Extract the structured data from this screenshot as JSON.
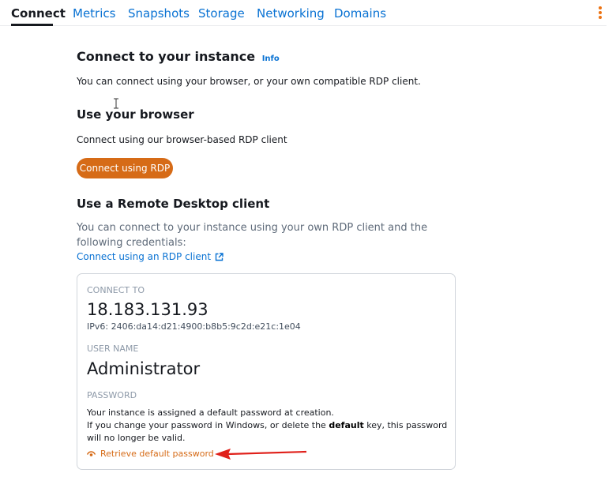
{
  "tabs": [
    {
      "label": "Connect",
      "active": true
    },
    {
      "label": "Metrics",
      "active": false
    },
    {
      "label": "Snapshots",
      "active": false
    },
    {
      "label": "Storage",
      "active": false
    },
    {
      "label": "Networking",
      "active": false
    },
    {
      "label": "Domains",
      "active": false
    }
  ],
  "connect": {
    "title": "Connect to your instance",
    "info_label": "Info",
    "intro": "You can connect using your browser, or your own compatible RDP client."
  },
  "browser": {
    "heading": "Use your browser",
    "text": "Connect using our browser-based RDP client",
    "button_label": "Connect using RDP"
  },
  "rdp_client": {
    "heading": "Use a Remote Desktop client",
    "description": "You can connect to your instance using your own RDP client and the following credentials:",
    "link_label": "Connect using an RDP client"
  },
  "credentials": {
    "connect_to_label": "CONNECT TO",
    "ip": "18.183.131.93",
    "ipv6": "IPv6: 2406:da14:d21:4900:b8b5:9c2d:e21c:1e04",
    "username_label": "USER NAME",
    "username": "Administrator",
    "password_label": "PASSWORD",
    "password_line1": "Your instance is assigned a default password at creation.",
    "password_line2_pre": "If you change your password in Windows, or delete the ",
    "password_line2_bold": "default",
    "password_line2_post": " key, this password will no longer be valid.",
    "retrieve_label": "Retrieve default password"
  },
  "colors": {
    "accent": "#d66b17",
    "link": "#0972d3",
    "annotation_arrow": "#e0201a"
  }
}
